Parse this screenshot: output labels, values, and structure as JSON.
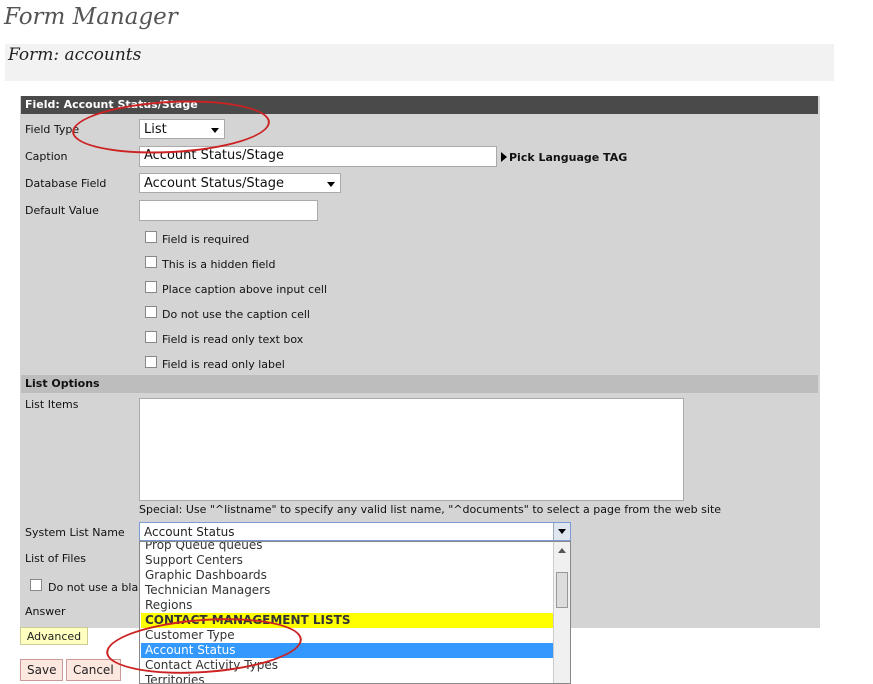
{
  "page": {
    "title": "Form Manager",
    "form_title": "Form: accounts"
  },
  "field_section": {
    "header": "Field: Account Status/Stage",
    "field_type_label": "Field Type",
    "field_type_value": "List",
    "caption_label": "Caption",
    "caption_value": "Account Status/Stage",
    "pick_language": "Pick Language TAG",
    "database_field_label": "Database Field",
    "database_field_value": "Account Status/Stage",
    "default_value_label": "Default Value",
    "default_value": "",
    "checkboxes": [
      {
        "label": "Field is required",
        "checked": false
      },
      {
        "label": "This is a hidden field",
        "checked": false
      },
      {
        "label": "Place caption above input cell",
        "checked": false
      },
      {
        "label": "Do not use the caption cell",
        "checked": false
      },
      {
        "label": "Field is read only text box",
        "checked": false
      },
      {
        "label": "Field is read only label",
        "checked": false
      }
    ]
  },
  "list_options": {
    "header": "List Options",
    "list_items_label": "List Items",
    "special_note": "Special: Use \"^listname\" to specify any valid list name, \"^documents\" to select a page from the web site",
    "system_list_label": "System List Name",
    "system_list_value": "Account Status",
    "list_of_files_label": "List of Files",
    "no_blank_label": "Do not use a blank",
    "answer_label": "Answer",
    "dropdown_options": [
      "Prop Queue queues",
      "Support Centers",
      "Graphic Dashboards",
      "Technician Managers",
      "Regions",
      "CONTACT MANAGEMENT LISTS",
      "Customer Type",
      "Account Status",
      "Contact Activity Types",
      "Territories"
    ],
    "highlighted_option": "CONTACT MANAGEMENT LISTS",
    "selected_option": "Account Status"
  },
  "buttons": {
    "advanced": "Advanced",
    "save": "Save",
    "cancel": "Cancel"
  },
  "colors": {
    "panel": "#d4d4d4",
    "header_dark": "#4a4a4a",
    "highlight_yellow": "#ffff00",
    "selection_blue": "#3399ff",
    "annotation_red": "#cc2222"
  }
}
